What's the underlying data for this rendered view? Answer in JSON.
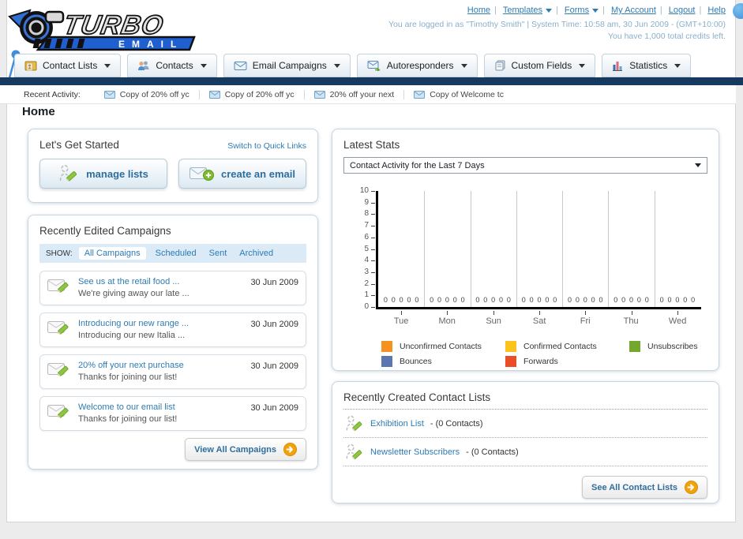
{
  "header": {
    "logo_title": "TURBO",
    "logo_subtitle": "EMAIL",
    "nav": [
      {
        "label": "Home",
        "dropdown": false
      },
      {
        "label": "Templates",
        "dropdown": true
      },
      {
        "label": "Forms",
        "dropdown": true
      },
      {
        "label": "My Account",
        "dropdown": false
      },
      {
        "label": "Logout",
        "dropdown": false
      },
      {
        "label": "Help",
        "dropdown": false
      }
    ],
    "login_status": "You are logged in as \"Timothy Smith\" | System Time: 10:58 am, 30 Jun 2009 - (GMT+10:00)",
    "credits": "You have 1,000 total credits left."
  },
  "tabs": [
    {
      "label": "Contact Lists"
    },
    {
      "label": "Contacts"
    },
    {
      "label": "Email Campaigns"
    },
    {
      "label": "Autoresponders"
    },
    {
      "label": "Custom Fields"
    },
    {
      "label": "Statistics"
    }
  ],
  "recent_activity": {
    "label": "Recent Activity:",
    "items": [
      {
        "text": "Copy of 20% off yc"
      },
      {
        "text": "Copy of 20% off yc"
      },
      {
        "text": "20% off your next "
      },
      {
        "text": "Copy of Welcome tc"
      }
    ]
  },
  "page_title": "Home",
  "get_started": {
    "title": "Let's Get Started",
    "switch_link": "Switch to Quick Links",
    "manage_lists_label": "manage lists",
    "create_email_label": "create an email"
  },
  "campaigns": {
    "title": "Recently Edited Campaigns",
    "show_label": "SHOW:",
    "filters": [
      {
        "label": "All Campaigns",
        "active": true
      },
      {
        "label": "Scheduled",
        "active": false
      },
      {
        "label": "Sent",
        "active": false
      },
      {
        "label": "Archived",
        "active": false
      }
    ],
    "rows": [
      {
        "title": "See us at the retail food ...",
        "subtitle": "We're giving away our late ...",
        "date": "30 Jun 2009"
      },
      {
        "title": "Introducing our new range ...",
        "subtitle": "Introducing our new Italia ...",
        "date": "30 Jun 2009"
      },
      {
        "title": "20% off your next purchase",
        "subtitle": "Thanks for joining our list!",
        "date": "30 Jun 2009"
      },
      {
        "title": "Welcome to our email list",
        "subtitle": "Thanks for joining our list!",
        "date": "30 Jun 2009"
      }
    ],
    "view_all_label": "View All Campaigns"
  },
  "latest_stats": {
    "title": "Latest Stats",
    "period_selected": "Contact Activity for the Last 7 Days"
  },
  "chart_data": {
    "type": "bar",
    "title": "Contact Activity for the Last 7 Days",
    "categories": [
      "Tue",
      "Mon",
      "Sun",
      "Sat",
      "Fri",
      "Thu",
      "Wed"
    ],
    "series": [
      {
        "name": "Unconfirmed Contacts",
        "color": "#F6921E",
        "values": [
          0,
          0,
          0,
          0,
          0,
          0,
          0
        ]
      },
      {
        "name": "Confirmed Contacts",
        "color": "#FCC21D",
        "values": [
          0,
          0,
          0,
          0,
          0,
          0,
          0
        ]
      },
      {
        "name": "Unsubscribes",
        "color": "#74A82A",
        "values": [
          0,
          0,
          0,
          0,
          0,
          0,
          0
        ]
      },
      {
        "name": "Bounces",
        "color": "#5B76B0",
        "values": [
          0,
          0,
          0,
          0,
          0,
          0,
          0
        ]
      },
      {
        "name": "Forwards",
        "color": "#E94E26",
        "values": [
          0,
          0,
          0,
          0,
          0,
          0,
          0
        ]
      }
    ],
    "xlabel": "",
    "ylabel": "",
    "ylim": [
      0,
      10
    ],
    "yticks": [
      0,
      1,
      2,
      3,
      4,
      5,
      6,
      7,
      8,
      9,
      10
    ],
    "grid": true,
    "legend_position": "bottom"
  },
  "contact_lists": {
    "title": "Recently Created Contact Lists",
    "items": [
      {
        "name": "Exhibition List",
        "count_text": "- (0 Contacts)"
      },
      {
        "name": "Newsletter Subscribers",
        "count_text": "- (0 Contacts)"
      }
    ],
    "see_all_label": "See All Contact Lists"
  }
}
